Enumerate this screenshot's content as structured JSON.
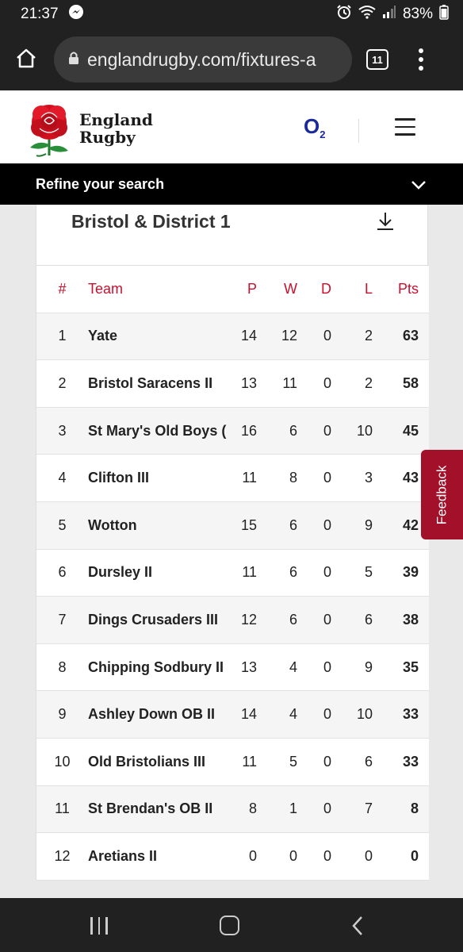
{
  "status_bar": {
    "time": "21:37",
    "battery": "83%"
  },
  "browser": {
    "url": "englandrugby.com/fixtures-a",
    "tab_count": "11"
  },
  "header": {
    "brand_line1": "England",
    "brand_line2": "Rugby",
    "sponsor": "O",
    "sponsor_sub": "2"
  },
  "refine": {
    "label": "Refine your search"
  },
  "league": {
    "title": "Bristol & District 1"
  },
  "table": {
    "columns": [
      "#",
      "Team",
      "P",
      "W",
      "D",
      "L",
      "Pts"
    ],
    "rows": [
      {
        "pos": "1",
        "team": "Yate",
        "p": "14",
        "w": "12",
        "d": "0",
        "l": "2",
        "pts": "63"
      },
      {
        "pos": "2",
        "team": "Bristol Saracens II",
        "p": "13",
        "w": "11",
        "d": "0",
        "l": "2",
        "pts": "58"
      },
      {
        "pos": "3",
        "team": "St Mary's Old Boys (",
        "p": "16",
        "w": "6",
        "d": "0",
        "l": "10",
        "pts": "45"
      },
      {
        "pos": "4",
        "team": "Clifton III",
        "p": "11",
        "w": "8",
        "d": "0",
        "l": "3",
        "pts": "43"
      },
      {
        "pos": "5",
        "team": "Wotton",
        "p": "15",
        "w": "6",
        "d": "0",
        "l": "9",
        "pts": "42"
      },
      {
        "pos": "6",
        "team": "Dursley II",
        "p": "11",
        "w": "6",
        "d": "0",
        "l": "5",
        "pts": "39"
      },
      {
        "pos": "7",
        "team": "Dings Crusaders III",
        "p": "12",
        "w": "6",
        "d": "0",
        "l": "6",
        "pts": "38"
      },
      {
        "pos": "8",
        "team": "Chipping Sodbury II",
        "p": "13",
        "w": "4",
        "d": "0",
        "l": "9",
        "pts": "35"
      },
      {
        "pos": "9",
        "team": "Ashley Down OB II",
        "p": "14",
        "w": "4",
        "d": "0",
        "l": "10",
        "pts": "33"
      },
      {
        "pos": "10",
        "team": "Old Bristolians III",
        "p": "11",
        "w": "5",
        "d": "0",
        "l": "6",
        "pts": "33"
      },
      {
        "pos": "11",
        "team": "St Brendan's OB II",
        "p": "8",
        "w": "1",
        "d": "0",
        "l": "7",
        "pts": "8"
      },
      {
        "pos": "12",
        "team": "Aretians II",
        "p": "0",
        "w": "0",
        "d": "0",
        "l": "0",
        "pts": "0"
      }
    ]
  },
  "feedback": {
    "label": "Feedback"
  },
  "colors": {
    "accent_red": "#c8102e",
    "feedback_bg": "#a3102a",
    "o2_blue": "#1a2a9a"
  },
  "icons": [
    "messenger-icon",
    "alarm-icon",
    "wifi-icon",
    "signal-icon",
    "home-icon",
    "lock-icon",
    "tabs-icon",
    "more-icon",
    "rose-logo-icon",
    "hamburger-icon",
    "chevron-down-icon",
    "download-icon",
    "recent-apps-icon",
    "home-nav-icon",
    "back-icon"
  ]
}
